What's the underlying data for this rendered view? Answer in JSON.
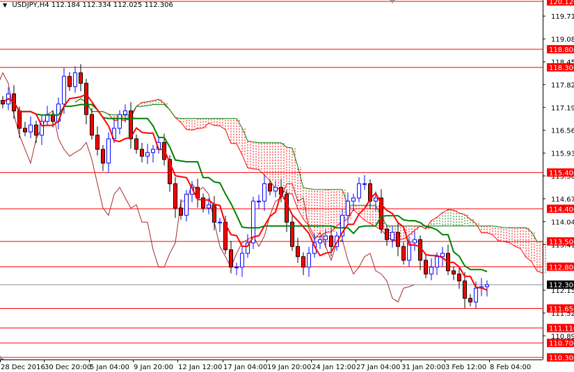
{
  "header": {
    "symbol": "USDJPY,H4",
    "open": "112.184",
    "high": "112.334",
    "low": "112.025",
    "close": "112.306"
  },
  "colors": {
    "bull": "#0000ff",
    "bear_body": "#ff0000",
    "bear_outline": "#000000",
    "tenkan": "#ff0000",
    "kijun": "#008000",
    "chikou": "#a52a2a",
    "level": "#ff0000",
    "cloud_up": "#008000",
    "cloud_down": "#ff0000"
  },
  "chart_data": {
    "type": "candlestick",
    "title": "USDJPY,H4",
    "indicators": [
      "Ichimoku Kinko Hyo",
      "horizontal levels"
    ],
    "ylim": [
      110.3,
      120.12
    ],
    "y_ticks": [
      "119.715",
      "119.085",
      "118.455",
      "117.825",
      "117.195",
      "116.565",
      "115.935",
      "115.305",
      "114.675",
      "114.045",
      "113.415",
      "112.155",
      "111.525",
      "110.895"
    ],
    "levels": [
      "120.120",
      "118.800",
      "118.300",
      "115.400",
      "114.400",
      "113.500",
      "112.800",
      "111.650",
      "111.110",
      "110.700",
      "110.300"
    ],
    "current_price": "112.306",
    "x_labels": [
      "28 Dec 2016",
      "30 Dec 20:00",
      "5 Jan 04:00",
      "9 Jan 20:00",
      "12 Jan 12:00",
      "17 Jan 04:00",
      "19 Jan 20:00",
      "24 Jan 12:00",
      "27 Jan 04:00",
      "31 Jan 20:00",
      "3 Feb 12:00",
      "8 Feb 04:00"
    ],
    "closes": [
      117.29,
      117.57,
      117.1,
      116.62,
      116.52,
      116.71,
      116.43,
      116.81,
      117.0,
      116.81,
      117.29,
      118.05,
      117.77,
      118.15,
      117.86,
      117.0,
      116.43,
      116.04,
      115.66,
      116.33,
      116.62,
      117.0,
      117.1,
      116.33,
      116.04,
      115.85,
      115.95,
      116.04,
      116.23,
      115.76,
      115.09,
      114.42,
      114.22,
      114.8,
      114.99,
      114.7,
      114.42,
      114.51,
      114.03,
      114.03,
      113.27,
      112.79,
      112.79,
      113.17,
      113.46,
      114.61,
      114.61,
      115.09,
      114.89,
      114.99,
      114.8,
      114.03,
      113.36,
      113.08,
      112.79,
      113.17,
      113.46,
      113.55,
      113.65,
      113.36,
      113.65,
      114.22,
      114.61,
      114.7,
      115.09,
      115.09,
      114.61,
      114.7,
      113.84,
      113.55,
      113.75,
      113.36,
      112.98,
      113.46,
      113.55,
      112.98,
      112.6,
      112.79,
      113.08,
      113.17,
      112.69,
      112.6,
      112.41,
      111.93,
      111.83,
      112.21,
      112.25,
      112.306
    ]
  }
}
